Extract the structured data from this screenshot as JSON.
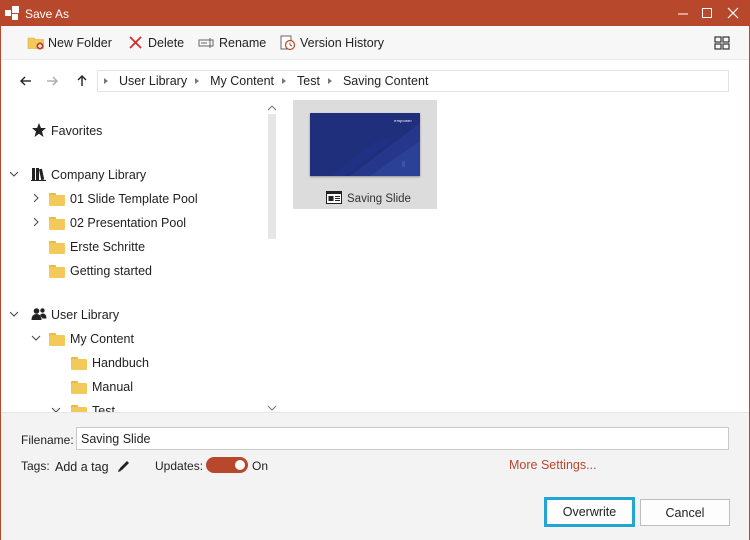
{
  "window": {
    "title": "Save As",
    "accent_color": "#b8482b",
    "app_icon": "app-logo-icon",
    "controls": [
      "minimize-icon",
      "maximize-icon",
      "close-icon"
    ]
  },
  "toolbar": {
    "new_folder": "New Folder",
    "delete": "Delete",
    "rename": "Rename",
    "version_history": "Version History",
    "view_toggle_icon": "grid-view-icon"
  },
  "navigation": {
    "back_icon": "arrow-left-icon",
    "forward_icon": "arrow-right-icon",
    "up_icon": "arrow-up-icon",
    "breadcrumb": [
      "User Library",
      "My Content",
      "Test",
      "Saving Content"
    ]
  },
  "tree": {
    "favorites": "Favorites",
    "company_library": "Company Library",
    "company_children": [
      "01 Slide Template Pool",
      "02 Presentation Pool",
      "Erste Schritte",
      "Getting started"
    ],
    "user_library": "User Library",
    "my_content": "My Content",
    "my_content_children": [
      "Handbuch",
      "Manual",
      "Test"
    ]
  },
  "content": {
    "items": [
      {
        "label": "Saving Slide",
        "type_icon": "slide-icon",
        "thumbnail_logo": "empower"
      }
    ]
  },
  "form": {
    "filename_label": "Filename:",
    "filename_value": "Saving Slide",
    "tags_label": "Tags:",
    "add_tag": "Add a tag",
    "updates_label": "Updates:",
    "updates_state": "On",
    "updates_on": true,
    "more_settings": "More Settings..."
  },
  "buttons": {
    "overwrite": "Overwrite",
    "cancel": "Cancel",
    "focus_color": "#22a6d6"
  }
}
